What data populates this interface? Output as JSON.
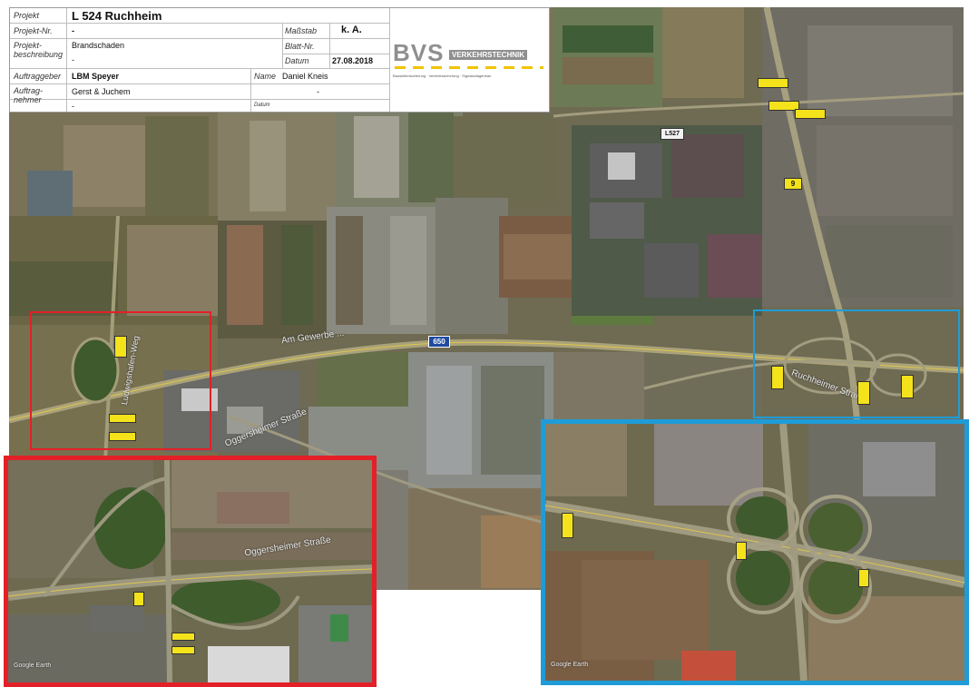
{
  "title_block": {
    "project_label": "Projekt",
    "project_value": "L 524 Ruchheim",
    "project_no_label": "Projekt-Nr.",
    "project_no_value": "-",
    "scale_label": "Maßstab",
    "scale_value": "k. A.",
    "description_label": "Projekt-beschreibung",
    "description_value": "Brandschaden",
    "description_value2": "-",
    "sheet_label": "Blatt-Nr.",
    "sheet_value": "",
    "date_label": "Datum",
    "date_value": "27.08.2018",
    "client_label": "Auftraggeber",
    "client_value": "LBM Speyer",
    "contractor_label": "Auftrag-nehmer",
    "contractor_value": "Gerst & Juchem",
    "contractor_value2": "-",
    "name_label": "Name",
    "name_value": "Daniel Kneis",
    "name_value2": "-",
    "sig_label": "Datum"
  },
  "logo": {
    "brand": "BVS",
    "brand_suffix": "VERKEHRSTECHNIK",
    "tagline": "Baustellensicherung · Verkehrssicherung · Signalanlagenbau"
  },
  "map": {
    "highway_shield": "650",
    "l527_shield": "L527",
    "b9_shield": "9",
    "road_label_main": "Am Gewerbe ...",
    "road_label_ogg": "Oggersheimer Straße",
    "road_label_ogg_inset": "Oggersheimer Straße",
    "road_label_lud": "Ludwigshafen-Weg",
    "road_label_ruch": "Ruchheimer Straße",
    "google_mark": "Google Earth"
  },
  "colors": {
    "red_frame": "#e32028",
    "blue_frame": "#1f9cd8",
    "sign_yellow": "#f4e21b"
  }
}
